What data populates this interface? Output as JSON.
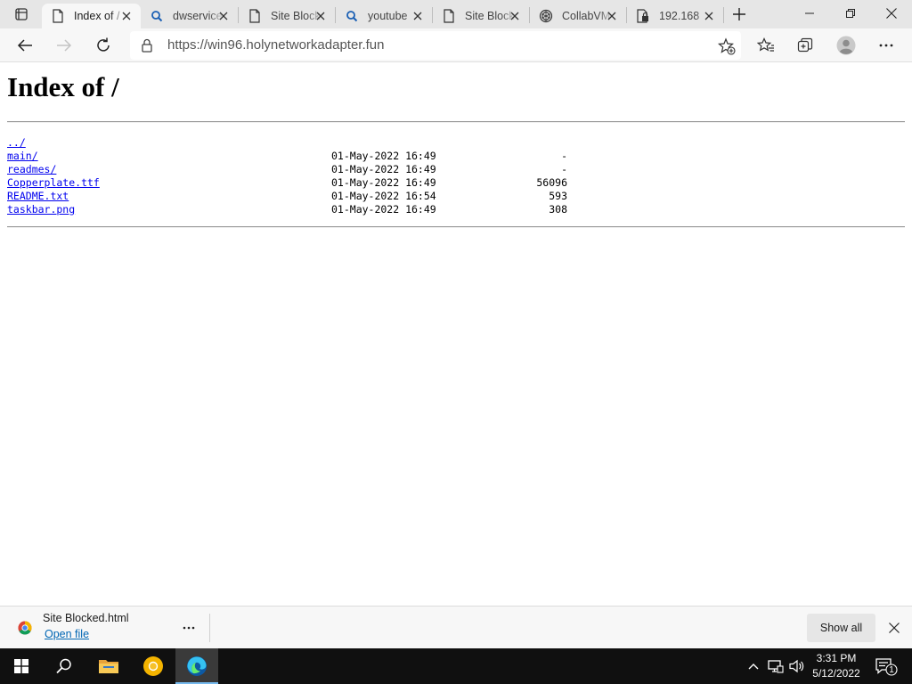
{
  "tabs": [
    {
      "title": "Index of /",
      "icon": "page-icon",
      "active": true
    },
    {
      "title": "dwservice",
      "icon": "search-icon",
      "active": false
    },
    {
      "title": "Site Blocked",
      "icon": "page-icon",
      "active": false
    },
    {
      "title": "youtube",
      "icon": "search-icon",
      "active": false
    },
    {
      "title": "Site Blocked",
      "icon": "page-icon",
      "active": false
    },
    {
      "title": "CollabVM",
      "icon": "collabvm-icon",
      "active": false
    },
    {
      "title": "192.168",
      "icon": "secure-page-icon",
      "active": false
    }
  ],
  "toolbar": {
    "url": "https://win96.holynetworkadapter.fun"
  },
  "page": {
    "heading": "Index of /",
    "entries": [
      {
        "name": "../",
        "date": "",
        "size": ""
      },
      {
        "name": "main/",
        "date": "01-May-2022 16:49",
        "size": "-"
      },
      {
        "name": "readmes/",
        "date": "01-May-2022 16:49",
        "size": "-"
      },
      {
        "name": "Copperplate.ttf",
        "date": "01-May-2022 16:49",
        "size": "56096"
      },
      {
        "name": "README.txt",
        "date": "01-May-2022 16:54",
        "size": "593"
      },
      {
        "name": "taskbar.png",
        "date": "01-May-2022 16:49",
        "size": "308"
      }
    ]
  },
  "download": {
    "filename": "Site Blocked.html",
    "open_label": "Open file",
    "show_all_label": "Show all"
  },
  "taskbar": {
    "time": "3:31 PM",
    "date": "5/12/2022",
    "notification_count": "1"
  },
  "colors": {
    "link": "#0000ee",
    "taskbar": "#101010",
    "accent": "#0078d4"
  }
}
